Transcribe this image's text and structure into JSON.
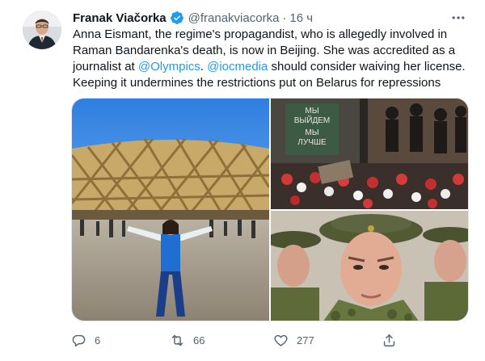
{
  "author": {
    "name": "Franak Viačorka",
    "handle": "@franakviacorka",
    "time": "16 ч"
  },
  "text": {
    "part1": "Anna Eismant, the regime's propagandist, who is allegedly involved in Raman Bandarenka's death, is now in Beijing. She was accredited as a journalist at ",
    "mention1": "@Olympics",
    "part2": ". ",
    "mention2": "@iocmedia",
    "part3": " should consider waiving her license. Keeping it undermines the restrictions put on Belarus for repressions"
  },
  "photos": {
    "sign_line1": "МЫ",
    "sign_line2": "ВЫЙДЕМ",
    "sign_line3": "МЫ",
    "sign_line4": "ЛУЧШЕ"
  },
  "actions": {
    "replies": "6",
    "retweets": "66",
    "likes": "277"
  },
  "icons": [
    "verified-badge-icon",
    "more-icon",
    "reply-icon",
    "retweet-icon",
    "like-icon",
    "share-icon"
  ],
  "colors": {
    "accent": "#1d9bf0",
    "muted": "#536471"
  }
}
